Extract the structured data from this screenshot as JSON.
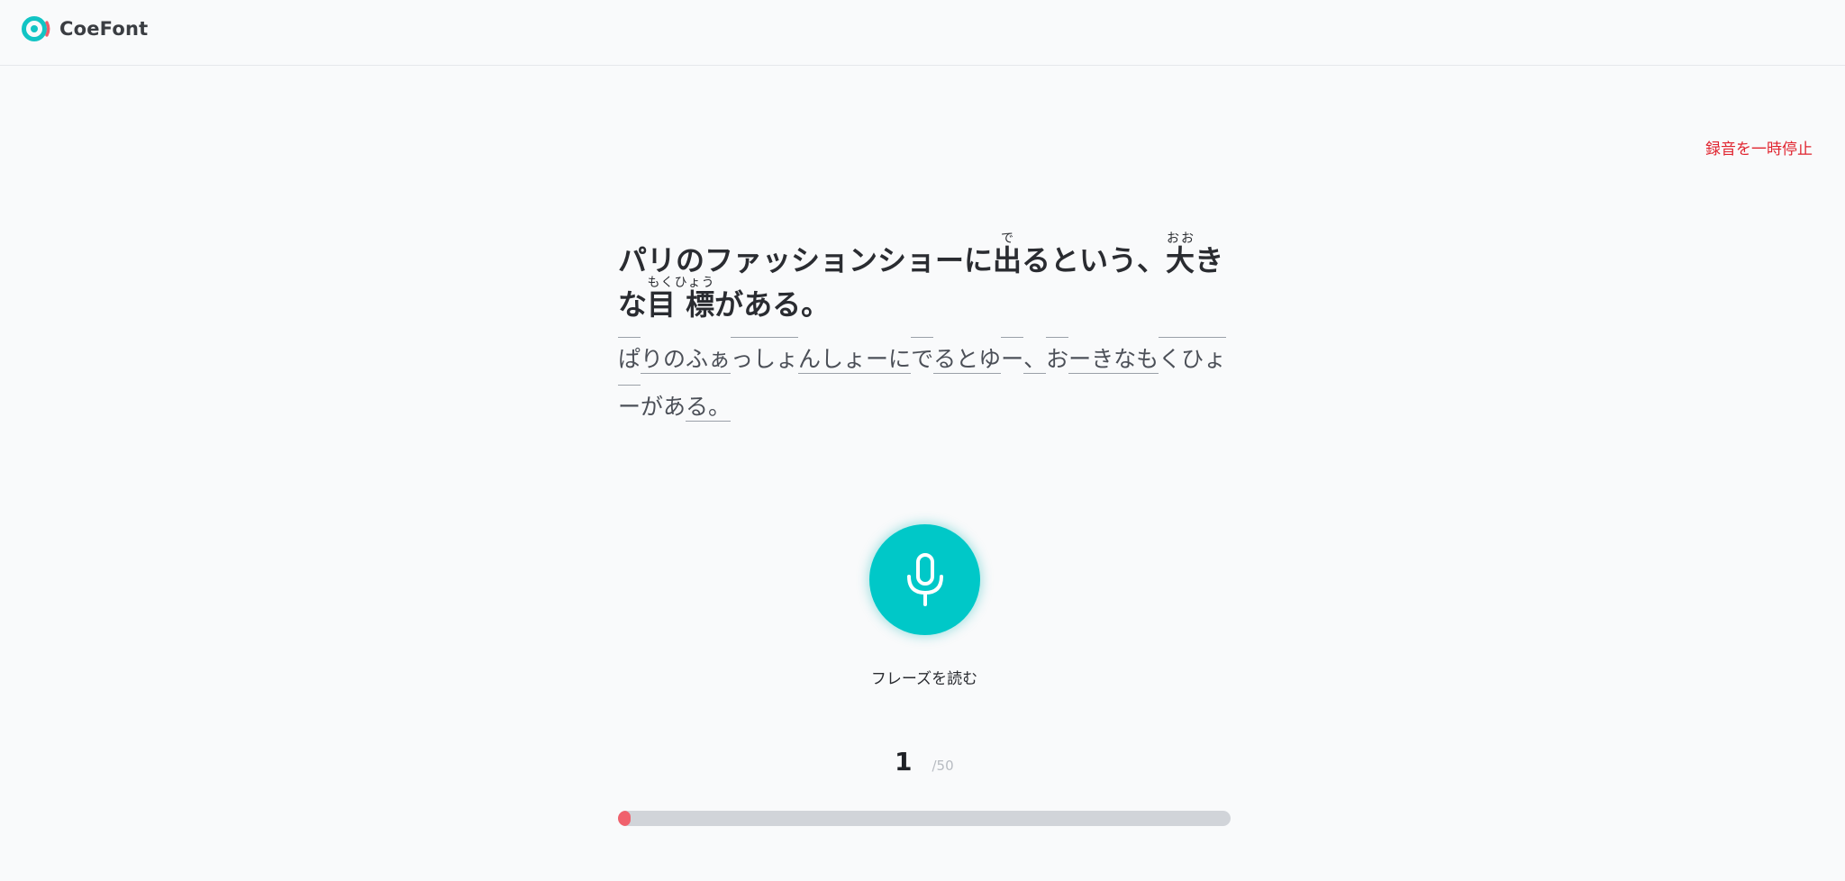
{
  "header": {
    "brand": "CoeFont"
  },
  "controls": {
    "pause_label": "録音を一時停止",
    "mic_label": "フレーズを読む"
  },
  "phrase": {
    "line1_a": "パリのファッションショーに",
    "line1_ruby1_base": "出",
    "line1_ruby1_reading": "で",
    "line1_b": "るという、",
    "line1_ruby2_base": "大",
    "line1_ruby2_reading": "おお",
    "line1_c": "き",
    "line2_a": "な",
    "line2_ruby_base": "目 標",
    "line2_ruby_reading": "もくひょう",
    "line2_b": "がある。"
  },
  "reading": {
    "segments": [
      "ぱ",
      "りのふぁ",
      "っしょ",
      "んしょーに",
      "で",
      "るとゆ",
      "ー",
      "、",
      "お",
      "ーきなも",
      "くひょ",
      "ー",
      "があ",
      "る。"
    ]
  },
  "progress": {
    "current": "1",
    "total": "/50",
    "fraction": 0.02
  },
  "colors": {
    "accent": "#00c8c8",
    "danger": "#e0242f",
    "progress_fill": "#f0616d",
    "progress_track": "#d1d4d9"
  }
}
